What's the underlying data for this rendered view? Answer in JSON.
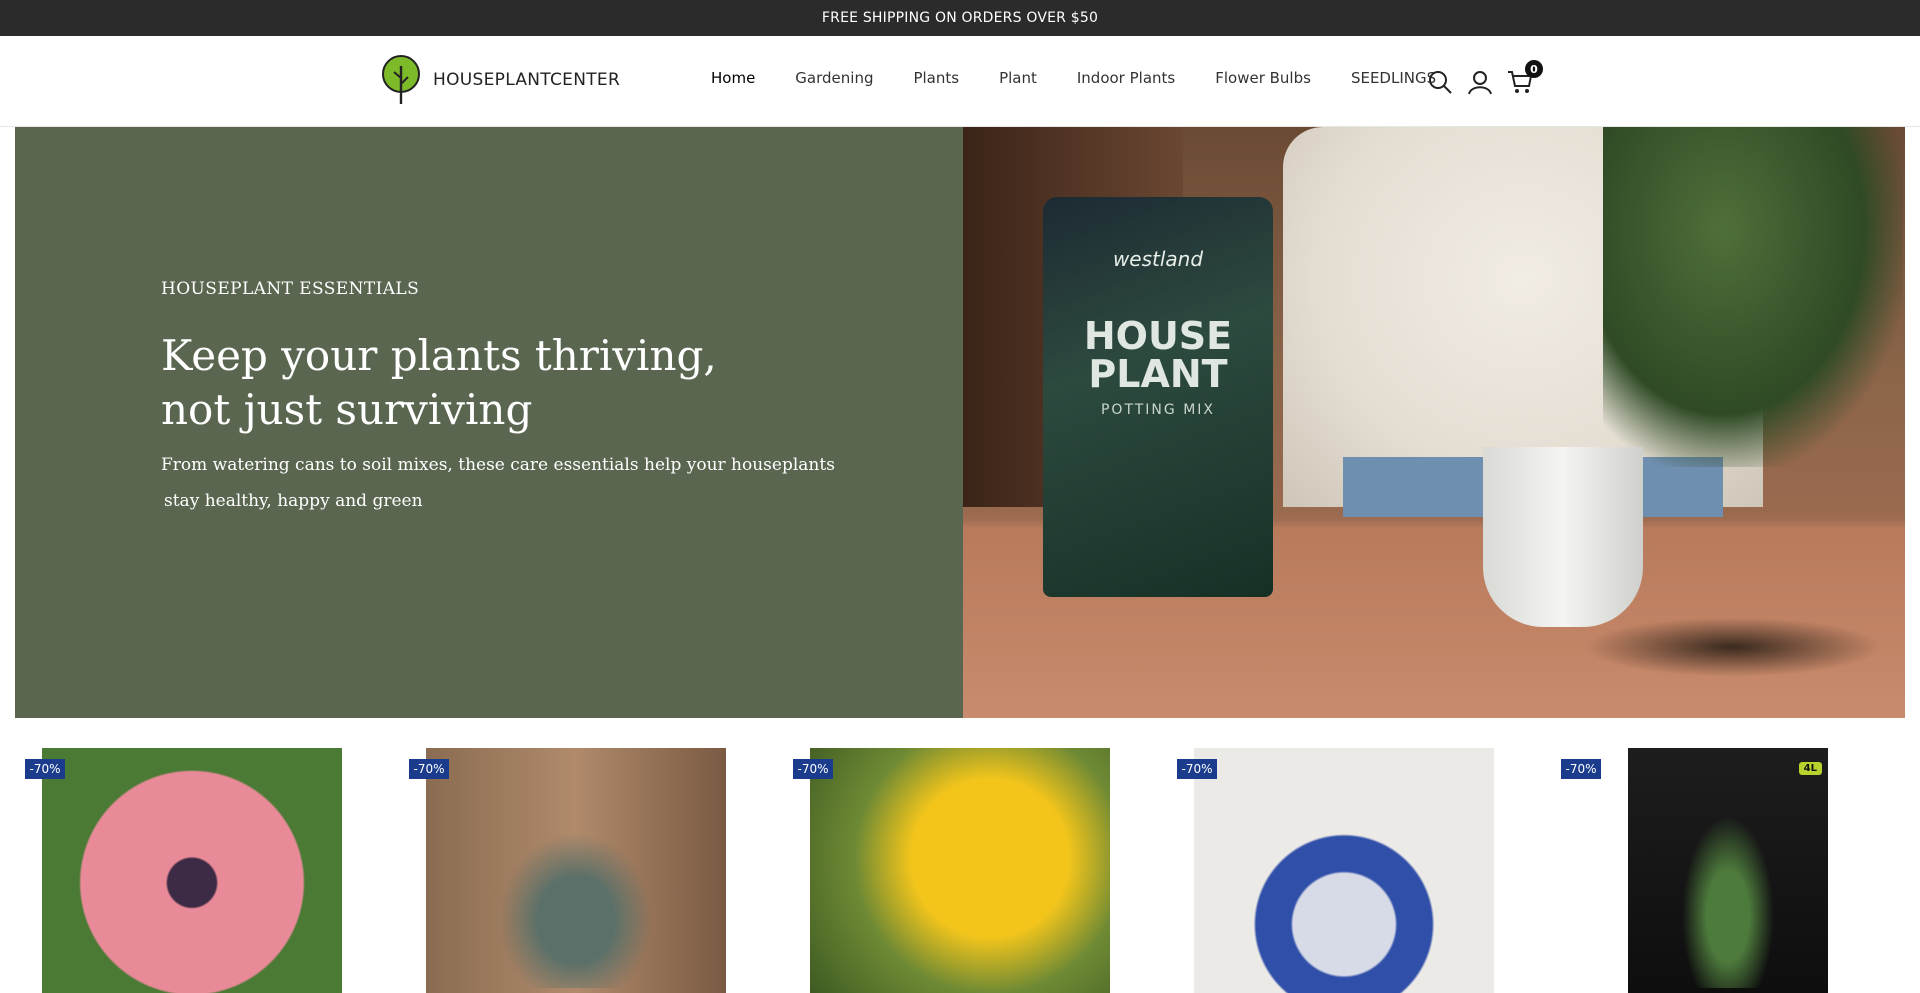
{
  "announcement": {
    "text": "FREE SHIPPING ON ORDERS OVER $50"
  },
  "header": {
    "logo_text": "HOUSEPLANTCENTER",
    "nav": [
      {
        "label": "Home"
      },
      {
        "label": "Gardening"
      },
      {
        "label": "Plants"
      },
      {
        "label": "Plant"
      },
      {
        "label": "Indoor Plants"
      },
      {
        "label": "Flower Bulbs"
      },
      {
        "label": "SEEDLINGS"
      }
    ],
    "icons": [
      "search-icon",
      "account-icon",
      "cart-icon"
    ],
    "cart_count": "0"
  },
  "hero": {
    "kicker": "HOUSEPLANT ESSENTIALS",
    "title_line1": "Keep your plants thriving,",
    "title_line2": "not just surviving",
    "subtitle_line1": "From watering cans to soil mixes, these care essentials help your houseplants",
    "subtitle_line2": "stay healthy, happy and green",
    "bg_color": "#5a6650",
    "image": {
      "bag_brand": "westland",
      "bag_title": "HOUSE PLANT",
      "bag_sub": "POTTING MIX"
    }
  },
  "products": [
    {
      "badge": "-70%"
    },
    {
      "badge": "-70%"
    },
    {
      "badge": "-70%"
    },
    {
      "badge": "-70%"
    },
    {
      "badge": "-70%",
      "label": "4L"
    }
  ],
  "colors": {
    "announce_bg": "#2b2b2b",
    "badge_bg": "#1b3c8c",
    "accent_green": "#7cba2a"
  }
}
